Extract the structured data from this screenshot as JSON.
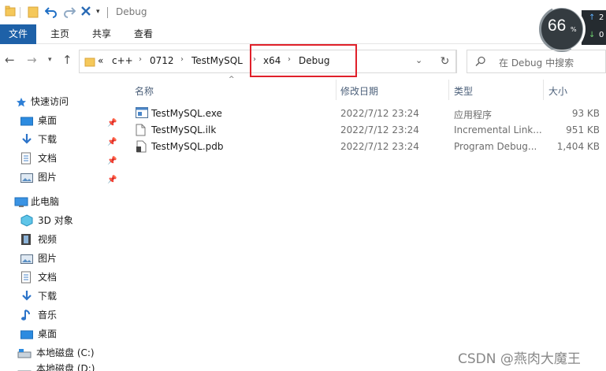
{
  "window": {
    "title": "Debug"
  },
  "quick_access_toolbar": {
    "icons": [
      "folder-icon",
      "folder-new-icon",
      "undo-icon",
      "redo-icon",
      "delete-icon",
      "dropdown-icon"
    ]
  },
  "ribbon": {
    "tabs": [
      "文件",
      "主页",
      "共享",
      "查看"
    ]
  },
  "speed_widget": {
    "percent": "66",
    "percent_sign": "%",
    "up_value": "2",
    "down_value": "0"
  },
  "address": {
    "overflow": "«",
    "crumbs": [
      "c++",
      "0712",
      "TestMySQL",
      "x64",
      "Debug"
    ]
  },
  "search": {
    "placeholder": "在 Debug 中搜索"
  },
  "sidebar": {
    "quick_access": "快速访问",
    "quick_items": [
      "桌面",
      "下载",
      "文档",
      "图片"
    ],
    "this_pc": "此电脑",
    "pc_items": [
      "3D 对象",
      "视频",
      "图片",
      "文档",
      "下载",
      "音乐",
      "桌面",
      "本地磁盘 (C:)",
      "本地磁盘 (D:)"
    ]
  },
  "columns": {
    "name": "名称",
    "date": "修改日期",
    "type": "类型",
    "size": "大小"
  },
  "files": [
    {
      "name": "TestMySQL.exe",
      "date": "2022/7/12 23:24",
      "type": "应用程序",
      "size": "93 KB",
      "icon": "exe-icon"
    },
    {
      "name": "TestMySQL.ilk",
      "date": "2022/7/12 23:24",
      "type": "Incremental Link...",
      "size": "951 KB",
      "icon": "file-icon"
    },
    {
      "name": "TestMySQL.pdb",
      "date": "2022/7/12 23:24",
      "type": "Program Debug...",
      "size": "1,404 KB",
      "icon": "pdb-icon"
    }
  ],
  "watermark": "CSDN @燕肉大魔王",
  "colors": {
    "ribbon_file": "#1e61a8",
    "highlight": "#e0202a",
    "header_text": "#4c607a"
  }
}
